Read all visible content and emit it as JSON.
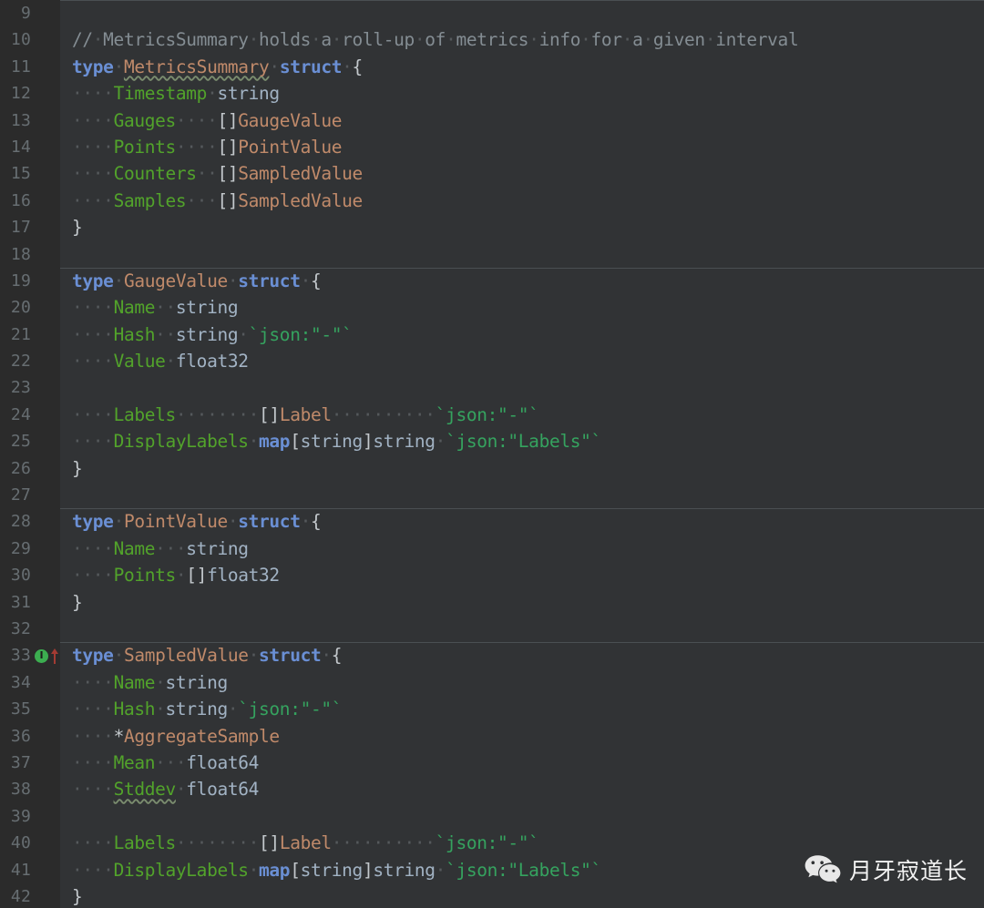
{
  "editor": {
    "theme_name": "darcula",
    "background": "#313335",
    "gutter_background": "#2b2b2b",
    "language": "Go",
    "first_visible_line": 9,
    "last_visible_line": 42,
    "colors": {
      "keyword": "#6a8fd4",
      "type": "#c08a6a",
      "field": "#52a32b",
      "builtin_type": "#a2b3c4",
      "struct_tag": "#35a35f",
      "comment": "#848d93",
      "punctuation": "#c3c8cc",
      "line_number": "#676e72",
      "whitespace_dot": "#55595c",
      "squiggle": "#7a8c6e",
      "separator": "#4a4f52",
      "gutter_icon_green": "#3cae50",
      "gutter_arrow_red": "#a33b33"
    }
  },
  "gutter": {
    "line_numbers": [
      9,
      10,
      11,
      12,
      13,
      14,
      15,
      16,
      17,
      18,
      19,
      20,
      21,
      22,
      23,
      24,
      25,
      26,
      27,
      28,
      29,
      30,
      31,
      32,
      33,
      34,
      35,
      36,
      37,
      38,
      39,
      40,
      41,
      42
    ],
    "markers": [
      {
        "line": 33,
        "icons": [
          "implemented-interface-icon",
          "arrow-up-icon"
        ],
        "label": "I"
      }
    ]
  },
  "code": {
    "lines": [
      {
        "n": 9,
        "separator": true,
        "text": ""
      },
      {
        "n": 10,
        "separator": false,
        "text": "// MetricsSummary holds a roll-up of metrics info for a given interval"
      },
      {
        "n": 11,
        "separator": false,
        "text": "type MetricsSummary struct {"
      },
      {
        "n": 12,
        "separator": false,
        "text": "    Timestamp string"
      },
      {
        "n": 13,
        "separator": false,
        "text": "    Gauges    []GaugeValue"
      },
      {
        "n": 14,
        "separator": false,
        "text": "    Points    []PointValue"
      },
      {
        "n": 15,
        "separator": false,
        "text": "    Counters  []SampledValue"
      },
      {
        "n": 16,
        "separator": false,
        "text": "    Samples   []SampledValue"
      },
      {
        "n": 17,
        "separator": false,
        "text": "}"
      },
      {
        "n": 18,
        "separator": false,
        "text": ""
      },
      {
        "n": 19,
        "separator": true,
        "text": "type GaugeValue struct {"
      },
      {
        "n": 20,
        "separator": false,
        "text": "    Name  string"
      },
      {
        "n": 21,
        "separator": false,
        "text": "    Hash  string `json:\"-\"`"
      },
      {
        "n": 22,
        "separator": false,
        "text": "    Value float32"
      },
      {
        "n": 23,
        "separator": false,
        "text": ""
      },
      {
        "n": 24,
        "separator": false,
        "text": "    Labels        []Label          `json:\"-\"`"
      },
      {
        "n": 25,
        "separator": false,
        "text": "    DisplayLabels map[string]string `json:\"Labels\"`"
      },
      {
        "n": 26,
        "separator": false,
        "text": "}"
      },
      {
        "n": 27,
        "separator": false,
        "text": ""
      },
      {
        "n": 28,
        "separator": true,
        "text": "type PointValue struct {"
      },
      {
        "n": 29,
        "separator": false,
        "text": "    Name   string"
      },
      {
        "n": 30,
        "separator": false,
        "text": "    Points []float32"
      },
      {
        "n": 31,
        "separator": false,
        "text": "}"
      },
      {
        "n": 32,
        "separator": false,
        "text": ""
      },
      {
        "n": 33,
        "separator": true,
        "text": "type SampledValue struct {"
      },
      {
        "n": 34,
        "separator": false,
        "text": "    Name string"
      },
      {
        "n": 35,
        "separator": false,
        "text": "    Hash string `json:\"-\"`"
      },
      {
        "n": 36,
        "separator": false,
        "text": "    *AggregateSample"
      },
      {
        "n": 37,
        "separator": false,
        "text": "    Mean   float64"
      },
      {
        "n": 38,
        "separator": false,
        "text": "    Stddev float64"
      },
      {
        "n": 39,
        "separator": false,
        "text": ""
      },
      {
        "n": 40,
        "separator": false,
        "text": "    Labels        []Label          `json:\"-\"`"
      },
      {
        "n": 41,
        "separator": false,
        "text": "    DisplayLabels map[string]string `json:\"Labels\"`"
      },
      {
        "n": 42,
        "separator": false,
        "text": "}"
      }
    ],
    "html_lines": [
      {
        "n": 9,
        "separator": true,
        "html": ""
      },
      {
        "n": 10,
        "separator": false,
        "html": "<span class=\"cmt\">//</span><span class=\"ws\">·</span><span class=\"cmt\">MetricsSummary</span><span class=\"ws\">·</span><span class=\"cmt\">holds</span><span class=\"ws\">·</span><span class=\"cmt\">a</span><span class=\"ws\">·</span><span class=\"cmt\">roll-up</span><span class=\"ws\">·</span><span class=\"cmt\">of</span><span class=\"ws\">·</span><span class=\"cmt\">metrics</span><span class=\"ws\">·</span><span class=\"cmt\">info</span><span class=\"ws\">·</span><span class=\"cmt\">for</span><span class=\"ws\">·</span><span class=\"cmt\">a</span><span class=\"ws\">·</span><span class=\"cmt\">given</span><span class=\"ws\">·</span><span class=\"cmt\">interval</span>"
      },
      {
        "n": 11,
        "separator": false,
        "html": "<span class=\"kw\">type</span><span class=\"ws\">·</span><span class=\"typ squig\">MetricsSummary</span><span class=\"ws\">·</span><span class=\"kw\">struct</span><span class=\"ws\">·</span><span class=\"punc\">{</span>"
      },
      {
        "n": 12,
        "separator": false,
        "html": "<span class=\"ws\">····</span><span class=\"fld\">Timestamp</span><span class=\"ws\">·</span><span class=\"bi\">string</span>"
      },
      {
        "n": 13,
        "separator": false,
        "html": "<span class=\"ws\">····</span><span class=\"fld\">Gauges</span><span class=\"ws\">····</span><span class=\"punc\">[]</span><span class=\"typ\">GaugeValue</span>"
      },
      {
        "n": 14,
        "separator": false,
        "html": "<span class=\"ws\">····</span><span class=\"fld\">Points</span><span class=\"ws\">····</span><span class=\"punc\">[]</span><span class=\"typ\">PointValue</span>"
      },
      {
        "n": 15,
        "separator": false,
        "html": "<span class=\"ws\">····</span><span class=\"fld\">Counters</span><span class=\"ws\">··</span><span class=\"punc\">[]</span><span class=\"typ\">SampledValue</span>"
      },
      {
        "n": 16,
        "separator": false,
        "html": "<span class=\"ws\">····</span><span class=\"fld\">Samples</span><span class=\"ws\">···</span><span class=\"punc\">[]</span><span class=\"typ\">SampledValue</span>"
      },
      {
        "n": 17,
        "separator": false,
        "html": "<span class=\"punc\">}</span>"
      },
      {
        "n": 18,
        "separator": false,
        "html": ""
      },
      {
        "n": 19,
        "separator": true,
        "html": "<span class=\"kw\">type</span><span class=\"ws\">·</span><span class=\"typ\">GaugeValue</span><span class=\"ws\">·</span><span class=\"kw\">struct</span><span class=\"ws\">·</span><span class=\"punc\">{</span>"
      },
      {
        "n": 20,
        "separator": false,
        "html": "<span class=\"ws\">····</span><span class=\"fld\">Name</span><span class=\"ws\">··</span><span class=\"bi\">string</span>"
      },
      {
        "n": 21,
        "separator": false,
        "html": "<span class=\"ws\">····</span><span class=\"fld\">Hash</span><span class=\"ws\">··</span><span class=\"bi\">string</span><span class=\"ws\">·</span><span class=\"tag\">`json:\"-\"`</span>"
      },
      {
        "n": 22,
        "separator": false,
        "html": "<span class=\"ws\">····</span><span class=\"fld\">Value</span><span class=\"ws\">·</span><span class=\"bi\">float32</span>"
      },
      {
        "n": 23,
        "separator": false,
        "html": ""
      },
      {
        "n": 24,
        "separator": false,
        "html": "<span class=\"ws\">····</span><span class=\"fld\">Labels</span><span class=\"ws\">········</span><span class=\"punc\">[]</span><span class=\"typ\">Label</span><span class=\"ws\">··········</span><span class=\"tag\">`json:\"-\"`</span>"
      },
      {
        "n": 25,
        "separator": false,
        "html": "<span class=\"ws\">····</span><span class=\"fld\">DisplayLabels</span><span class=\"ws\">·</span><span class=\"kw\">map</span><span class=\"punc\">[</span><span class=\"bi\">string</span><span class=\"punc\">]</span><span class=\"bi\">string</span><span class=\"ws\">·</span><span class=\"tag\">`json:\"Labels\"`</span>"
      },
      {
        "n": 26,
        "separator": false,
        "html": "<span class=\"punc\">}</span>"
      },
      {
        "n": 27,
        "separator": false,
        "html": ""
      },
      {
        "n": 28,
        "separator": true,
        "html": "<span class=\"kw\">type</span><span class=\"ws\">·</span><span class=\"typ\">PointValue</span><span class=\"ws\">·</span><span class=\"kw\">struct</span><span class=\"ws\">·</span><span class=\"punc\">{</span>"
      },
      {
        "n": 29,
        "separator": false,
        "html": "<span class=\"ws\">····</span><span class=\"fld\">Name</span><span class=\"ws\">···</span><span class=\"bi\">string</span>"
      },
      {
        "n": 30,
        "separator": false,
        "html": "<span class=\"ws\">····</span><span class=\"fld\">Points</span><span class=\"ws\">·</span><span class=\"punc\">[]</span><span class=\"bi\">float32</span>"
      },
      {
        "n": 31,
        "separator": false,
        "html": "<span class=\"punc\">}</span>"
      },
      {
        "n": 32,
        "separator": false,
        "html": ""
      },
      {
        "n": 33,
        "separator": true,
        "html": "<span class=\"kw\">type</span><span class=\"ws\">·</span><span class=\"typ\">SampledValue</span><span class=\"ws\">·</span><span class=\"kw\">struct</span><span class=\"ws\">·</span><span class=\"punc\">{</span>"
      },
      {
        "n": 34,
        "separator": false,
        "html": "<span class=\"ws\">····</span><span class=\"fld\">Name</span><span class=\"ws\">·</span><span class=\"bi\">string</span>"
      },
      {
        "n": 35,
        "separator": false,
        "html": "<span class=\"ws\">····</span><span class=\"fld\">Hash</span><span class=\"ws\">·</span><span class=\"bi\">string</span><span class=\"ws\">·</span><span class=\"tag\">`json:\"-\"`</span>"
      },
      {
        "n": 36,
        "separator": false,
        "html": "<span class=\"ws\">····</span><span class=\"punc\">*</span><span class=\"typ\">AggregateSample</span>"
      },
      {
        "n": 37,
        "separator": false,
        "html": "<span class=\"ws\">····</span><span class=\"fld\">Mean</span><span class=\"ws\">···</span><span class=\"bi\">float64</span>"
      },
      {
        "n": 38,
        "separator": false,
        "html": "<span class=\"ws\">····</span><span class=\"fld squig\">Stddev</span><span class=\"ws\">·</span><span class=\"bi\">float64</span>"
      },
      {
        "n": 39,
        "separator": false,
        "html": ""
      },
      {
        "n": 40,
        "separator": false,
        "html": "<span class=\"ws\">····</span><span class=\"fld\">Labels</span><span class=\"ws\">········</span><span class=\"punc\">[]</span><span class=\"typ\">Label</span><span class=\"ws\">··········</span><span class=\"tag\">`json:\"-\"`</span>"
      },
      {
        "n": 41,
        "separator": false,
        "html": "<span class=\"ws\">····</span><span class=\"fld\">DisplayLabels</span><span class=\"ws\">·</span><span class=\"kw\">map</span><span class=\"punc\">[</span><span class=\"bi\">string</span><span class=\"punc\">]</span><span class=\"bi\">string</span><span class=\"ws\">·</span><span class=\"tag\">`json:\"Labels\"`</span>"
      },
      {
        "n": 42,
        "separator": false,
        "html": "<span class=\"punc\">}</span>"
      }
    ]
  },
  "watermark": {
    "icon": "wechat-icon",
    "text": "月牙寂道长"
  }
}
